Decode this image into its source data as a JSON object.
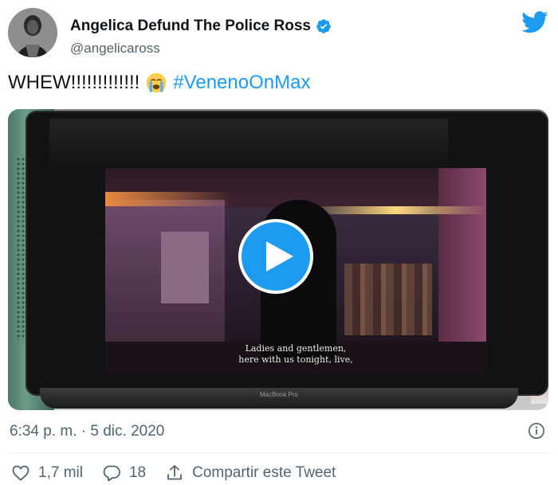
{
  "author": {
    "display_name": "Angelica Defund The Police Ross",
    "handle": "@angelicaross",
    "verified": true
  },
  "icons": {
    "brand": "twitter-bird-icon",
    "verified": "verified-badge-icon",
    "emoji": "crying-face-emoji",
    "play": "play-icon",
    "info": "info-icon",
    "like": "heart-icon",
    "reply": "reply-icon",
    "share": "share-icon"
  },
  "tweet": {
    "text": "WHEW!!!!!!!!!!!!!",
    "hashtag": "#VenenoOnMax"
  },
  "media": {
    "subtitle_line1": "Ladies and gentlemen,",
    "subtitle_line2": "here with us tonight, live,",
    "laptop_label": "MacBook Pro"
  },
  "meta": {
    "timestamp": "6:34 p. m. · 5 dic. 2020"
  },
  "actions": {
    "likes": "1,7 mil",
    "replies": "18",
    "share_label": "Compartir este Tweet"
  },
  "colors": {
    "accent": "#1d9bf0",
    "text": "#0f1419",
    "muted": "#536471"
  }
}
